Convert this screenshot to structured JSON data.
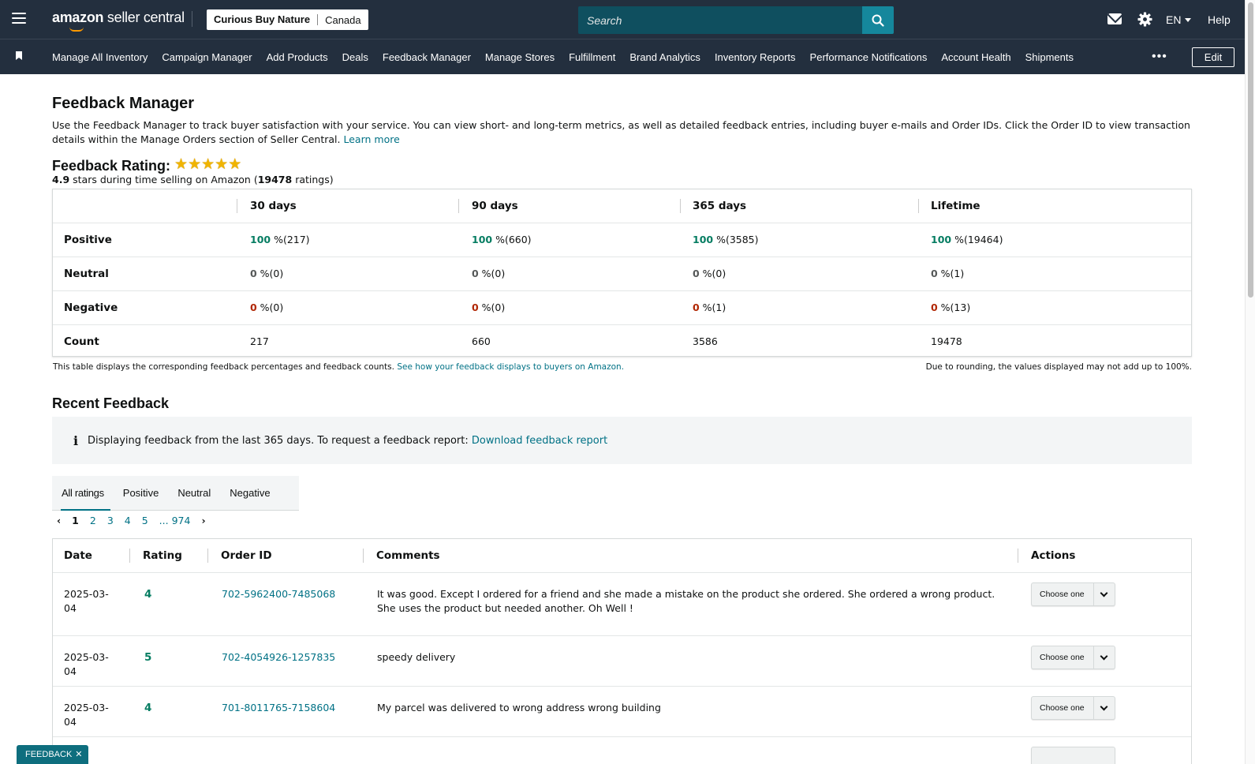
{
  "header": {
    "logo_brand": "amazon",
    "logo_suffix": "seller central",
    "store_name": "Curious Buy Nature",
    "marketplace": "Canada",
    "search_placeholder": "Search",
    "language": "EN",
    "help_label": "Help",
    "icons": [
      "menu-icon",
      "search-icon",
      "mail-icon",
      "gear-icon"
    ]
  },
  "nav": {
    "items": [
      "Manage All Inventory",
      "Campaign Manager",
      "Add Products",
      "Deals",
      "Feedback Manager",
      "Manage Stores",
      "Fulfillment",
      "Brand Analytics",
      "Inventory Reports",
      "Performance Notifications",
      "Account Health",
      "Shipments"
    ],
    "more_label": "•••",
    "edit_label": "Edit"
  },
  "page": {
    "title": "Feedback Manager",
    "description": "Use the Feedback Manager to track buyer satisfaction with your service. You can view short- and long-term metrics, as well as detailed feedback entries, including buyer e-mails and Order IDs. Click the Order ID to view transaction details within the Manage Orders section of Seller Central.",
    "learn_more": "Learn more",
    "rating_label": "Feedback Rating:",
    "stars": 5,
    "rating_value": "4.9",
    "rating_text_1": " stars during time selling on Amazon (",
    "rating_count": "19478",
    "rating_text_2": " ratings)"
  },
  "summary": {
    "headers": [
      "30 days",
      "90 days",
      "365 days",
      "Lifetime"
    ],
    "rows": [
      {
        "label": "Positive",
        "type": "pos",
        "cells": [
          [
            "100",
            " %(217)"
          ],
          [
            "100",
            " %(660)"
          ],
          [
            "100",
            " %(3585)"
          ],
          [
            "100",
            " %(19464)"
          ]
        ]
      },
      {
        "label": "Neutral",
        "type": "zero",
        "cells": [
          [
            "0",
            " %(0)"
          ],
          [
            "0",
            " %(0)"
          ],
          [
            "0",
            " %(0)"
          ],
          [
            "0",
            " %(1)"
          ]
        ]
      },
      {
        "label": "Negative",
        "type": "neg",
        "cells": [
          [
            "0",
            " %(0)"
          ],
          [
            "0",
            " %(0)"
          ],
          [
            "0",
            " %(1)"
          ],
          [
            "0",
            " %(13)"
          ]
        ]
      },
      {
        "label": "Count",
        "type": "count",
        "cells": [
          [
            "217",
            ""
          ],
          [
            "660",
            ""
          ],
          [
            "3586",
            ""
          ],
          [
            "19478",
            ""
          ]
        ]
      }
    ],
    "footnote_text": "This table displays the corresponding feedback percentages and feedback counts.",
    "footnote_link": "See how your feedback displays to buyers on Amazon.",
    "rounding_note": "Due to rounding, the values displayed may not add up to 100%."
  },
  "recent": {
    "title": "Recent Feedback",
    "info_icon": "i",
    "info_text": "Displaying feedback from the last 365 days. To request a feedback report:",
    "info_link": "Download feedback report",
    "tabs": [
      "All ratings",
      "Positive",
      "Neutral",
      "Negative"
    ],
    "active_tab": "All ratings",
    "pages": [
      "1",
      "2",
      "3",
      "4",
      "5"
    ],
    "current_page": "1",
    "ellipsis": "...",
    "last_page": "974",
    "columns": [
      "Date",
      "Rating",
      "Order ID",
      "Comments",
      "Actions"
    ],
    "rows": [
      {
        "date": "2025-03-04",
        "rating": "4",
        "order_id": "702-5962400-7485068",
        "comment": "It was good. Except I ordered for a friend and she made a mistake on the product she ordered. She ordered a wrong product. She uses the product but needed another. Oh Well !",
        "action": "Choose one"
      },
      {
        "date": "2025-03-04",
        "rating": "5",
        "order_id": "702-4054926-1257835",
        "comment": "speedy delivery",
        "action": "Choose one"
      },
      {
        "date": "2025-03-04",
        "rating": "4",
        "order_id": "701-8011765-7158604",
        "comment": "My parcel was delivered to wrong address wrong building",
        "action": "Choose one"
      }
    ]
  },
  "feedback_widget": {
    "label": "FEEDBACK",
    "close": "✕"
  },
  "colors": {
    "header_bg": "#232f3e",
    "link": "#007185",
    "positive": "#067d62",
    "negative": "#b12704",
    "star": "#f0b400"
  }
}
